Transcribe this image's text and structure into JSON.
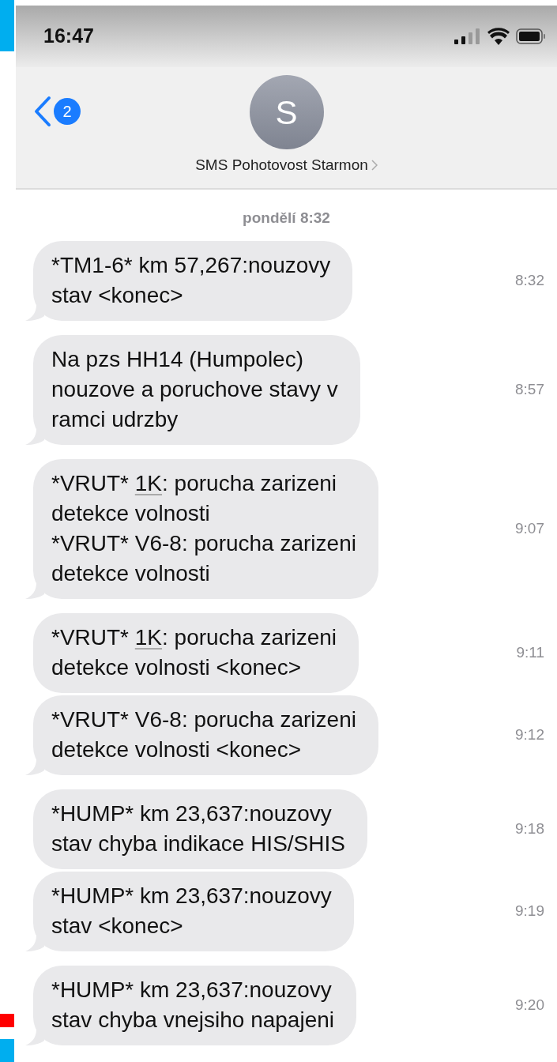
{
  "status_bar": {
    "time": "16:47"
  },
  "header": {
    "unread_count": "2",
    "avatar_initial": "S",
    "contact_name": "SMS Pohotovost Starmon"
  },
  "date_label": "pondělí 8:32",
  "messages": [
    {
      "segments": [
        {
          "kind": "text",
          "text": "*TM1-6* km 57,267:nouzovy\nstav <konec>"
        }
      ],
      "time": "8:32",
      "tail": true
    },
    {
      "segments": [
        {
          "kind": "text",
          "text": "Na pzs HH14 (Humpolec)\nnouzove a poruchove stavy v\nramci udrzby"
        }
      ],
      "time": "8:57",
      "tail": true
    },
    {
      "segments": [
        {
          "kind": "text",
          "text": "*VRUT* "
        },
        {
          "kind": "link",
          "text": "1K"
        },
        {
          "kind": "text",
          "text": ": porucha zarizeni\ndetekce volnosti\n*VRUT* V6-8: porucha zarizeni\ndetekce volnosti"
        }
      ],
      "time": "9:07",
      "tail": true
    },
    {
      "segments": [
        {
          "kind": "text",
          "text": "*VRUT* "
        },
        {
          "kind": "link",
          "text": "1K"
        },
        {
          "kind": "text",
          "text": ": porucha zarizeni\ndetekce volnosti <konec>"
        }
      ],
      "time": "9:11",
      "tail": false
    },
    {
      "segments": [
        {
          "kind": "text",
          "text": "*VRUT* V6-8: porucha zarizeni\ndetekce volnosti <konec>"
        }
      ],
      "time": "9:12",
      "tail": true
    },
    {
      "segments": [
        {
          "kind": "text",
          "text": "*HUMP* km 23,637:nouzovy\nstav chyba indikace HIS/SHIS"
        }
      ],
      "time": "9:18",
      "tail": false
    },
    {
      "segments": [
        {
          "kind": "text",
          "text": "*HUMP* km 23,637:nouzovy\nstav <konec>"
        }
      ],
      "time": "9:19",
      "tail": true
    },
    {
      "segments": [
        {
          "kind": "text",
          "text": "*HUMP* km 23,637:nouzovy\nstav chyba vnejsiho napajeni"
        }
      ],
      "time": "9:20",
      "tail": true
    }
  ]
}
